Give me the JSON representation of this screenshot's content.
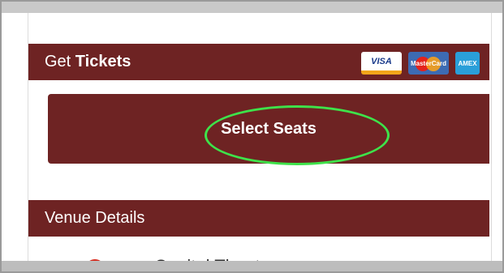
{
  "tickets_section": {
    "title_plain": "Get ",
    "title_bold": "Tickets",
    "cards": [
      {
        "label": "VISA",
        "icon": "visa-card-icon"
      },
      {
        "label": "MasterCard",
        "icon": "mastercard-icon"
      },
      {
        "label": "AMEX",
        "icon": "amex-card-icon"
      }
    ]
  },
  "select_seats": {
    "label": "Select Seats",
    "highlight_color": "#3ee24a"
  },
  "venue_section": {
    "title": "Venue Details",
    "venue_name": "Capital Theatre"
  },
  "colors": {
    "header_bg": "#6e2323",
    "text_light": "#ffffff"
  }
}
